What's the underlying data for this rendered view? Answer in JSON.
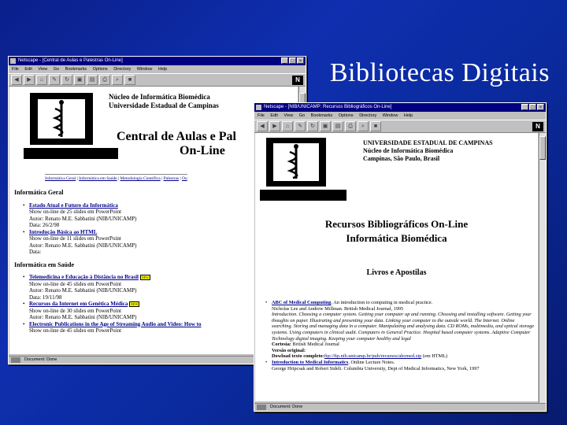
{
  "slide": {
    "title": "Bibliotecas Digitais"
  },
  "window1": {
    "title": "Netscape - [Central de Aulas e Palestras On-Line]",
    "menu": [
      "File",
      "Edit",
      "View",
      "Go",
      "Bookmarks",
      "Options",
      "Directory",
      "Window",
      "Help"
    ],
    "toolbar_icons": [
      "back-icon",
      "forward-icon",
      "home-icon",
      "edit-icon",
      "reload-icon",
      "images-icon",
      "open-icon",
      "print-icon",
      "find-icon",
      "stop-icon"
    ],
    "header_line1": "Núcleo de Informática Biomédica",
    "header_line2": "Universidade Estadual de Campinas",
    "page_title_1": "Central de Aulas e Pal",
    "page_title_2": "On-Line",
    "nav": [
      "Informática Geral",
      "Informática em Saúde",
      "Metodologia Científica",
      "Palestras",
      "Ou"
    ],
    "sections": [
      {
        "heading": "Informática Geral",
        "items": [
          {
            "link": "Estado Atual e Futuro da Informática",
            "lines": [
              "Show on-line de 25 slides em PowerPoint",
              "Autor: Renato M.E. Sabbatini (NIB/UNICAMP)",
              "Data: 26/2/98"
            ]
          },
          {
            "link": "Introdução Básica ao HTML",
            "lines": [
              "Show on-line de 11 slides em PowerPoint",
              "Autor: Renato M.E. Sabbatini (NIB/UNICAMP)",
              "Data:"
            ]
          }
        ]
      },
      {
        "heading": "Informática em Saúde",
        "items": [
          {
            "link": "Telemedicina e Educação à Distância no Brasil",
            "new": "NEW",
            "lines": [
              "Show on-line de 45 slides em PowerPoint",
              "Autor: Renato M.E. Sabbatini (NIB/UNICAMP)",
              "Data: 19/11/98"
            ]
          },
          {
            "link": "Recursos da Internet em Genética Médica",
            "new": "NEW",
            "lines": [
              "Show on-line de 30 slides em PowerPoint",
              "Autor: Renato M.E. Sabbatini (NIB/UNICAMP)"
            ]
          },
          {
            "link": "Electronic Publications in the Age of Streaming Audio and Video: How to",
            "lines": [
              "Show on-line de 45 slides em PowerPoint"
            ]
          }
        ]
      }
    ],
    "status": "Document: Done"
  },
  "window2": {
    "title": "Netscape - [NIB/UNICAMP: Recursos Bibliográficos On-Line]",
    "menu": [
      "File",
      "Edit",
      "View",
      "Go",
      "Bookmarks",
      "Options",
      "Directory",
      "Window",
      "Help"
    ],
    "header_line1": "UNIVERSIDADE ESTADUAL DE CAMPINAS",
    "header_line2": "Núcleo de Informática Biomédica",
    "header_line3": "Campinas, São Paulo, Brasil",
    "page_title_1": "Recursos Bibliográficos On-Line",
    "page_title_2": "Informática Biomédica",
    "section": "Livros e Apostilas",
    "item1": {
      "link": "ABC of Medical Computing",
      "desc": ". An introduction to computing in medical practice.",
      "authors": "Nicholas Lee and Andrew Millman. British Medical Journal, 1995",
      "abstract": "Introduction. Choosing a computer system. Getting your computer up and running. Choosing and installing software. Getting your thoughts on paper. Illustrating and presenting your data. Linking your computer to the outside world. The Internet. Online searching. Storing and managing data in a computer. Manipulating and analysing data. CD ROMs, multimedia, and optical storage systems. Using computers in clinical audit. Computers in General Practice. Hospital based computer systems. Adaptive Computer Technology digital imaging. Keeping your computer healthy and legal",
      "cortesia_label": "Cortesia:",
      "cortesia_value": " British Medical Journal",
      "versao_label": "Versão original:",
      "download_label": "Dowload texto completo:",
      "download_link": "ftp://ftp.nib.unicamp.br/pub/recursos/abcmed.zip",
      "download_suffix": " (em HTML)"
    },
    "item2": {
      "link": "Introduction to Medical Informatics",
      "desc": ". Online Lecture Notes.",
      "authors": "George Hripcsak and Robert Sideli. Columbia University, Dept of Medical Informatics, New York, 1997"
    },
    "status": "Document: Done"
  }
}
